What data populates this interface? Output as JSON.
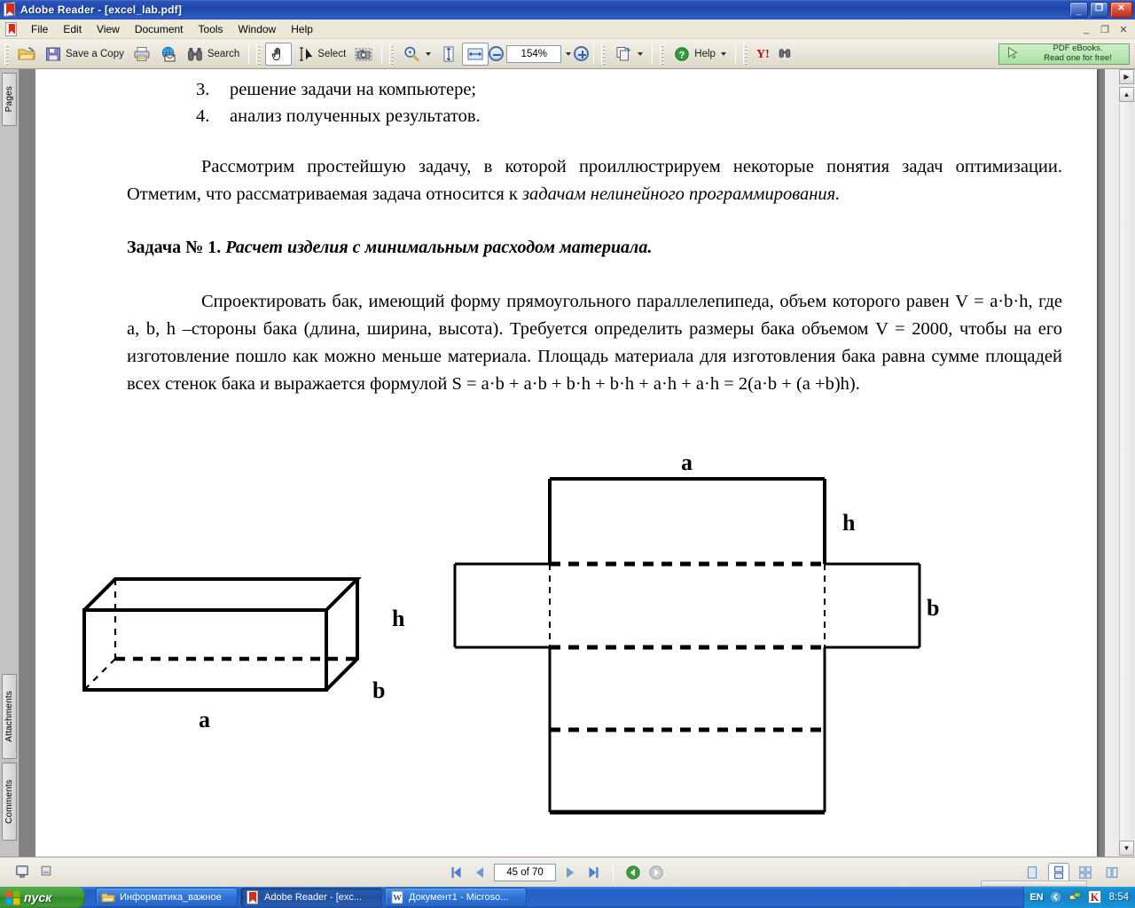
{
  "window": {
    "title": "Adobe Reader - [excel_lab.pdf]",
    "app_icon": "adobe-reader-icon",
    "minimize": "_",
    "maximize": "❐",
    "close": "✕",
    "mdi_minimize": "_",
    "mdi_restore": "❐",
    "mdi_close": "✕"
  },
  "menu": {
    "items": [
      {
        "label": "File"
      },
      {
        "label": "Edit"
      },
      {
        "label": "View"
      },
      {
        "label": "Document"
      },
      {
        "label": "Tools"
      },
      {
        "label": "Window"
      },
      {
        "label": "Help"
      }
    ]
  },
  "toolbar": {
    "open_label": "",
    "save_copy_label": "Save a Copy",
    "print_label": "",
    "email_label": "",
    "search_label": "Search",
    "hand_label": "",
    "select_label": "Select",
    "snapshot_label": "",
    "zoom_tool_label": "",
    "fit_page_label": "",
    "fit_width_label": "",
    "zoom_out_label": "",
    "zoom_value": "154%",
    "zoom_in_label": "",
    "pages_tool_label": "",
    "help_label": "Help",
    "yahoo_label": "Y!",
    "ad": {
      "line1": "PDF eBooks.",
      "line2": "Read one for free!"
    }
  },
  "navpane": {
    "tabs": [
      {
        "label": "Pages"
      },
      {
        "label": "Attachments"
      },
      {
        "label": "Comments"
      }
    ]
  },
  "document": {
    "list": [
      {
        "number": "3.",
        "text": "решение задачи на компьютере;"
      },
      {
        "number": "4.",
        "text": "анализ полученных результатов."
      }
    ],
    "paragraph1_a": "Рассмотрим простейшую задачу, в которой проиллюстрируем некоторые понятия задач оптимизации. Отметим, что рассматриваемая задача относится к ",
    "paragraph1_italic": "задачам нелинейного программирования.",
    "heading_bold": "Задача № 1. ",
    "heading_italic": "Расчет изделия с минимальным расходом материала.",
    "paragraph2": "Спроектировать бак, имеющий форму прямоугольного параллелепипеда, объем которого равен V = a·b·h, где a, b, h –стороны бака (длина, ширина, высота). Требуется определить размеры бака объемом V = 2000, чтобы на его изготовление пошло как можно меньше материала. Площадь материала для изготовления бака равна сумме площадей всех стенок бака и выражается формулой S = a·b + a·b + b·h + b·h + a·h + a·h = 2(a·b + (a +b)h).",
    "figures": {
      "box3d": {
        "label_a": "a",
        "label_b": "b",
        "label_h": "h"
      },
      "net": {
        "label_a": "a",
        "label_b": "b",
        "label_h": "h"
      }
    }
  },
  "statusbar": {
    "page_value": "45 of 70",
    "first_label": "⏮",
    "prev_label": "◀",
    "next_label": "▶",
    "last_label": "⏭",
    "prev_view_label": "◀",
    "next_view_label": "▶",
    "layout_single": "single-page",
    "layout_continuous": "continuous",
    "layout_facing": "facing",
    "layout_continuous_facing": "continuous-facing"
  },
  "taskbar": {
    "start_label": "пуск",
    "items": [
      {
        "label": "Информатика_важное",
        "icon": "folder-icon"
      },
      {
        "label": "Adobe Reader - [exc...",
        "icon": "adobe-reader-icon"
      },
      {
        "label": "Документ1 - Microso...",
        "icon": "word-icon"
      }
    ],
    "tray": {
      "language": "EN",
      "clock": "8:54"
    }
  },
  "colors": {
    "titlebar_blue": "#1f47ae",
    "taskbar_blue": "#245fc4",
    "start_green": "#3f9836",
    "toolbar_bg": "#e6e3d6",
    "ad_green": "#a9dfa2",
    "accent_red": "#d92b1c"
  }
}
